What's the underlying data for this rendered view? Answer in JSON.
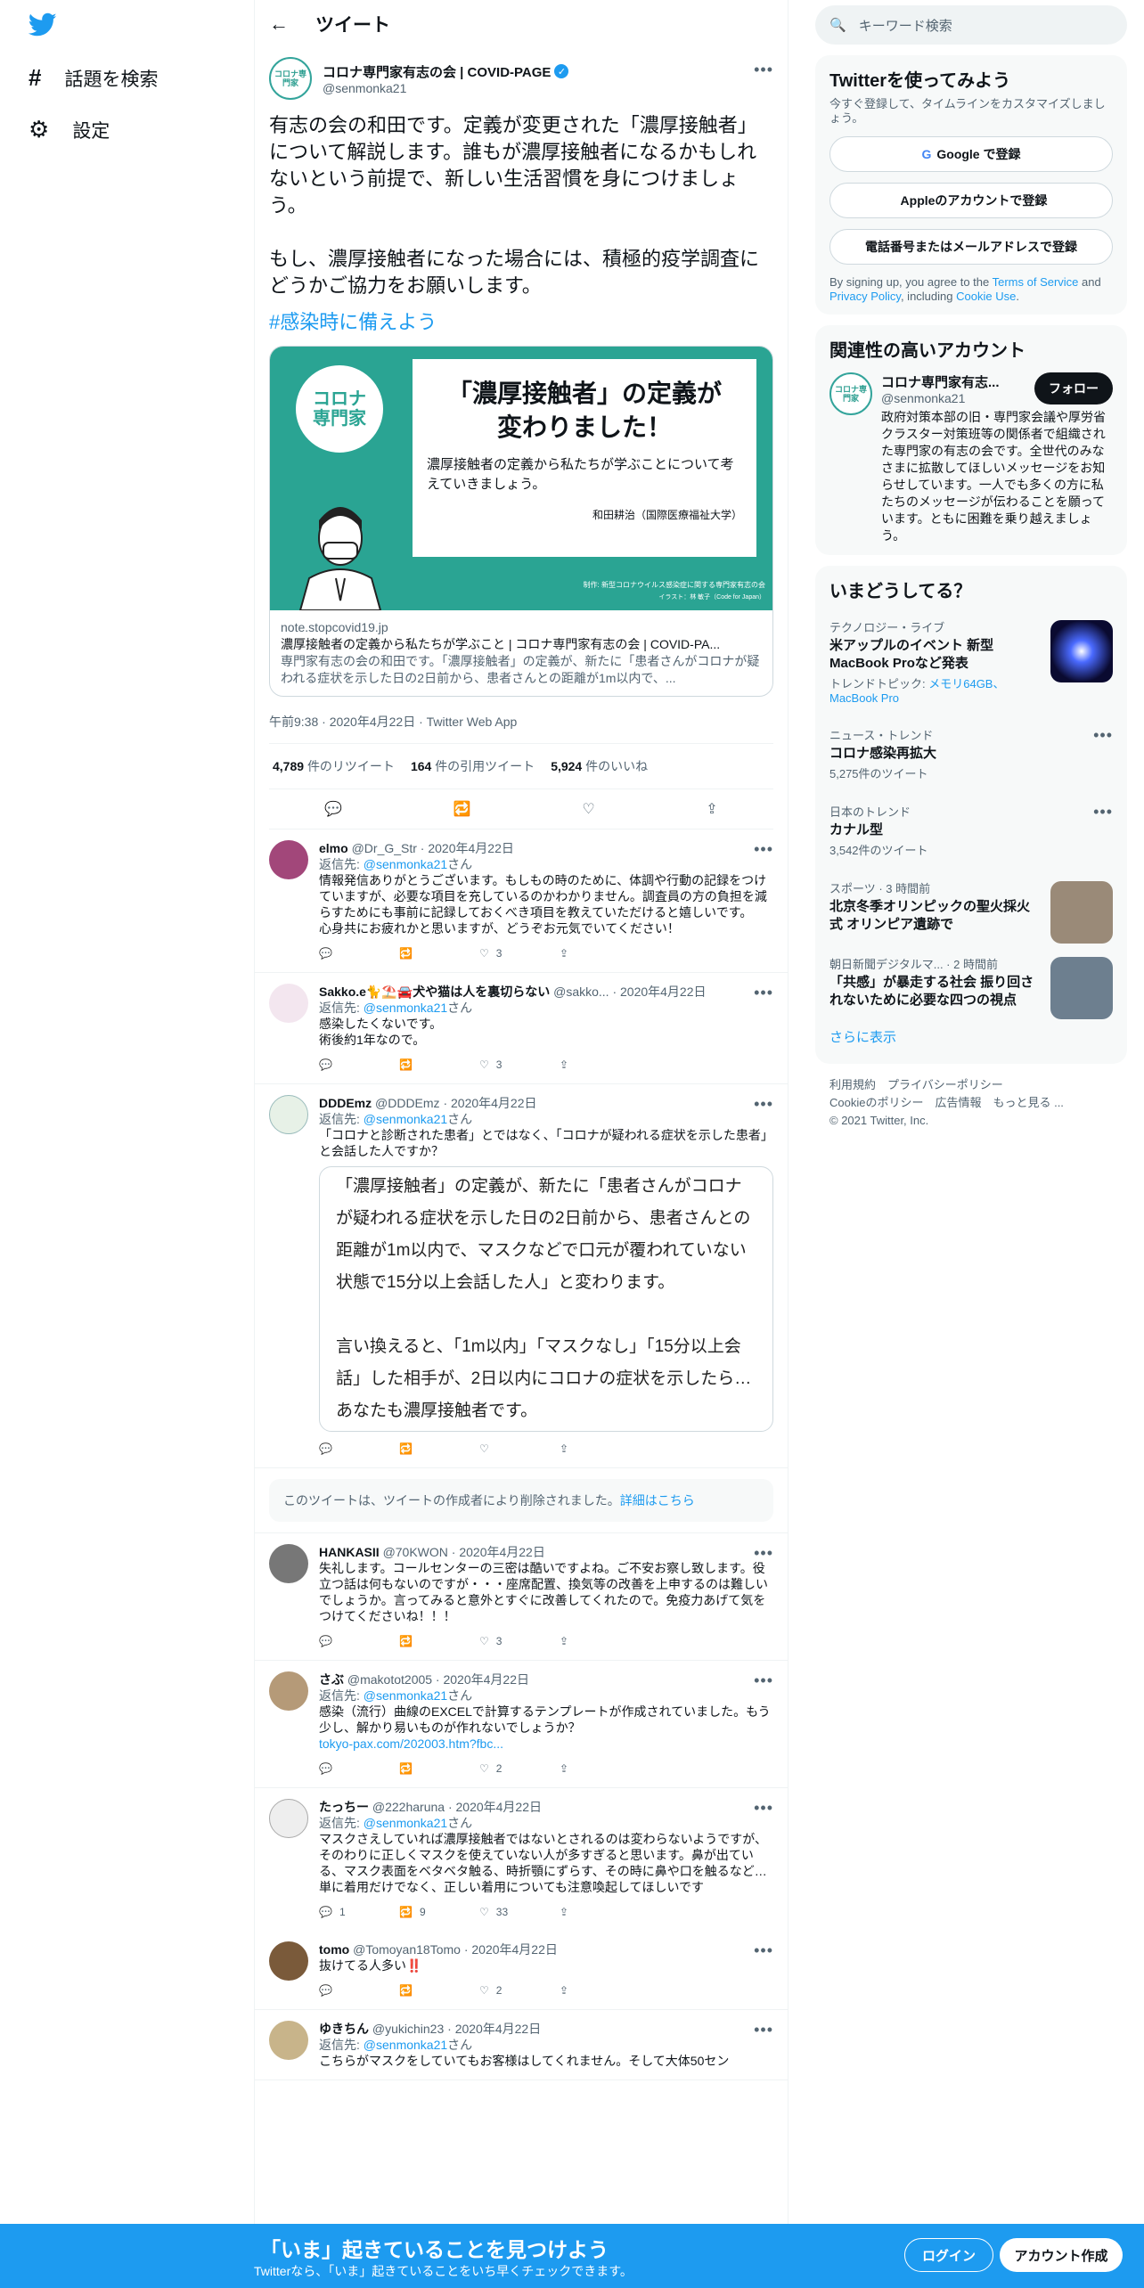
{
  "nav": {
    "explore": "話題を検索",
    "settings": "設定"
  },
  "header": {
    "title": "ツイート"
  },
  "tweet": {
    "name": "コロナ専門家有志の会 | COVID-PAGE",
    "handle": "@senmonka21",
    "avatar_text": "コロナ専門家",
    "text": "有志の会の和田です。定義が変更された「濃厚接触者」について解説します。誰もが濃厚接触者になるかもしれないという前提で、新しい生活習慣を身につけましょう。\n\nもし、濃厚接触者になった場合には、積極的疫学調査にどうかご協力をお願いします。",
    "hashtag": "#感染時に備えよう",
    "card": {
      "img_title": "「濃厚接触者」の定義が変わりました！",
      "img_sub": "濃厚接触者の定義から私たちが学ぶことについて考えていきましょう。",
      "img_author": "和田耕治（国際医療福祉大学）",
      "img_credit": "制作: 新型コロナウイルス感染症に関する専門家有志の会",
      "img_credit2": "イラスト：林 敏子（Code for Japan）",
      "domain": "note.stopcovid19.jp",
      "title": "濃厚接触者の定義から私たちが学ぶこと | コロナ専門家有志の会 | COVID-PA...",
      "desc": "専門家有志の会の和田です。「濃厚接触者」の定義が、新たに「患者さんがコロナが疑われる症状を示した日の2日前から、患者さんとの距離が1m以内で、..."
    },
    "time": "午前9:38 · 2020年4月22日 · Twitter Web App",
    "retweets": "4,789",
    "retweets_label": "件のリツイート",
    "quotes": "164",
    "quotes_label": "件の引用ツイート",
    "likes": "5,924",
    "likes_label": "件のいいね"
  },
  "replies": [
    {
      "name": "elmo",
      "handle": "@Dr_G_Str · 2020年4月22日",
      "to": "返信先: ",
      "to_user": "@senmonka21",
      "to_suffix": "さん",
      "text": "情報発信ありがとうございます。もしもの時のために、体調や行動の記録をつけていますが、必要な項目を充しているのかわかりません。調査員の方の負担を減らすためにも事前に記録しておくべき項目を教えていただけると嬉しいです。\n心身共にお疲れかと思いますが、どうぞお元気でいてください！",
      "likes": "3"
    },
    {
      "name": "Sakko.e🐈⛱️🚘犬や猫は人を裏切らない",
      "handle": "@sakko... · 2020年4月22日",
      "to": "返信先: ",
      "to_user": "@senmonka21",
      "to_suffix": "さん",
      "text": "感染したくないです。\n術後約1年なので。",
      "likes": "3"
    },
    {
      "name": "DDDEmz",
      "handle": "@DDDEmz · 2020年4月22日",
      "to": "返信先: ",
      "to_user": "@senmonka21",
      "to_suffix": "さん",
      "text": "「コロナと診断された患者」とではなく、「コロナが疑われる症状を示した患者」と会話した人ですか？",
      "quote": "「濃厚接触者」の定義が、新たに「患者さんがコロナが疑われる症状を示した日の2日前から、患者さんとの距離が1m以内で、マスクなどで口元が覆われていない状態で15分以上会話した人」と変わります。\n\n言い換えると、「1m以内」「マスクなし」「15分以上会話」した相手が、2日以内にコロナの症状を示したら…あなたも濃厚接触者です。",
      "likes": ""
    },
    {
      "name": "HANKASII",
      "handle": "@70KWON · 2020年4月22日",
      "text": "失礼します。コールセンターの三密は酷いですよね。ご不安お察し致します。役立つ話は何もないのですが・・・座席配置、換気等の改善を上申するのは難しいでしょうか。言ってみると意外とすぐに改善してくれたので。免疫力あげて気をつけてくださいね！！！",
      "likes": "3"
    },
    {
      "name": "さぶ",
      "handle": "@makotot2005 · 2020年4月22日",
      "to": "返信先: ",
      "to_user": "@senmonka21",
      "to_suffix": "さん",
      "text": "感染（流行）曲線のEXCELで計算するテンプレートが作成されていました。もう少し、解かり易いものが作れないでしょうか？",
      "link": "tokyo-pax.com/202003.htm?fbc...",
      "likes": "2"
    },
    {
      "name": "たっちー",
      "handle": "@222haruna · 2020年4月22日",
      "to": "返信先: ",
      "to_user": "@senmonka21",
      "to_suffix": "さん",
      "text": "マスクさえしていれば濃厚接触者ではないとされるのは変わらないようですが、そのわりに正しくマスクを使えていない人が多すぎると思います。鼻が出ている、マスク表面をベタベタ触る、時折顎にずらす、その時に鼻や口を触るなど…\n単に着用だけでなく、正しい着用についても注意喚起してほしいです",
      "replies": "1",
      "retweets": "9",
      "likes": "33"
    },
    {
      "name": "tomo",
      "handle": "@Tomoyan18Tomo · 2020年4月22日",
      "text": "抜けてる人多い‼️",
      "likes": "2"
    },
    {
      "name": "ゆきちん",
      "handle": "@yukichin23 · 2020年4月22日",
      "to": "返信先: ",
      "to_user": "@senmonka21",
      "to_suffix": "さん",
      "text": "こちらがマスクをしていてもお客様はしてくれません。そして大体50セン",
      "likes": ""
    }
  ],
  "deleted_notice": {
    "text": "このツイートは、ツイートの作成者により削除されました。",
    "link": "詳細はこちら"
  },
  "sidebar": {
    "search_placeholder": "キーワード検索",
    "signup": {
      "title": "Twitterを使ってみよう",
      "desc": "今すぐ登録して、タイムラインをカスタマイズしましょう。",
      "google": "Google で登録",
      "apple": "Appleのアカウントで登録",
      "phone": "電話番号またはメールアドレスで登録",
      "terms_pre": "By signing up, you agree to the ",
      "terms": "Terms of Service",
      "terms_mid": " and ",
      "privacy": "Privacy Policy",
      "terms_mid2": ", including ",
      "cookie": "Cookie Use",
      "terms_end": "."
    },
    "related": {
      "title": "関連性の高いアカウント",
      "name": "コロナ専門家有志...",
      "handle": "@senmonka21",
      "follow": "フォロー",
      "bio": "政府対策本部の旧・専門家会議や厚労省クラスター対策班等の関係者で組織された専門家の有志の会です。全世代のみなさまに拡散してほしいメッセージをお知らせしています。一人でも多くの方に私たちのメッセージが伝わることを願っています。ともに困難を乗り越えましょう。"
    },
    "trends": {
      "title": "いまどうしてる？",
      "items": [
        {
          "category": "テクノロジー・ライブ",
          "title": "米アップルのイベント 新型MacBook Proなど発表",
          "extra_pre": "トレンドトピック: ",
          "extra": "メモリ64GB、MacBook Pro"
        },
        {
          "category": "ニュース・トレンド",
          "title": "コロナ感染再拡大",
          "count": "5,275件のツイート"
        },
        {
          "category": "日本のトレンド",
          "title": "カナル型",
          "count": "3,542件のツイート"
        },
        {
          "category": "スポーツ · 3 時間前",
          "title": "北京冬季オリンピックの聖火採火式 オリンピア遺跡で"
        },
        {
          "category": "朝日新聞デジタルマ... · 2 時間前",
          "title": "「共感」が暴走する社会 振り回されないために必要な四つの視点"
        }
      ],
      "more": "さらに表示"
    },
    "footer": {
      "line1": "利用規約　プライバシーポリシー",
      "line2": "Cookieのポリシー　広告情報　もっと見る ...",
      "line3": "© 2021 Twitter, Inc."
    }
  },
  "bottom": {
    "title": "「いま」起きていることを見つけよう",
    "sub": "Twitterなら、「いま」起きていることをいち早くチェックできます。",
    "login": "ログイン",
    "signup": "アカウント作成"
  }
}
